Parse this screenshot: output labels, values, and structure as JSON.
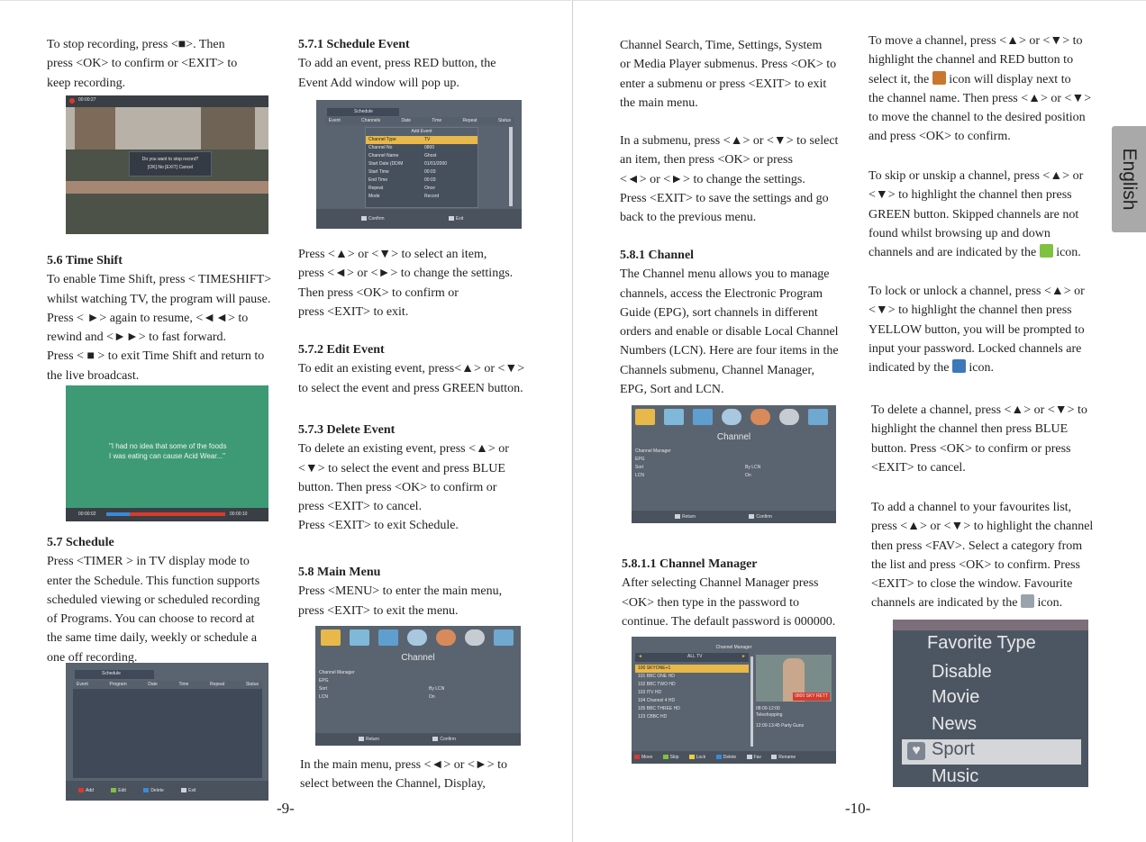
{
  "left_page": {
    "page_number": "-9-",
    "col1": {
      "recording_lines": [
        "To stop recording, press <■>. Then",
        "press <OK> to confirm or <EXIT> to",
        "keep recording."
      ],
      "recording_dialog_text": "Do you want to stop record?",
      "recording_dialog_sub": "[OK]  No [EXIT] Cancel",
      "recording_time": "00:00:27",
      "timeshift_heading": "5.6 Time Shift",
      "timeshift_lines": [
        "To enable Time Shift, press < TIMESHIFT>",
        "whilst watching TV, the program will pause.",
        "Press < ►> again to resume, <◄◄> to",
        "rewind and <►►> to fast forward.",
        "Press < ■ > to exit Time Shift and return to",
        "the live broadcast."
      ],
      "timeshift_caption": "\"I had no idea that some of the foods\nI was eating can cause Acid Wear...\"",
      "timeshift_time_left": "00:00:02",
      "timeshift_time_right": "00:00:10",
      "schedule_heading": "5.7 Schedule",
      "schedule_lines": [
        "Press <TIMER > in TV display mode to",
        "enter the Schedule. This function supports",
        "scheduled viewing or scheduled recording",
        "of Programs. You can choose to record at",
        "the same time daily, weekly or schedule a",
        "one off recording."
      ],
      "schedule_window_title": "Schedule",
      "schedule_columns": [
        "Event",
        "Program",
        "Date",
        "Time",
        "Repeat",
        "Status"
      ],
      "schedule_buttons": [
        "Add",
        "Edit",
        "Delete",
        "Exit"
      ]
    },
    "col2": {
      "event_heading": "5.7.1 Schedule Event",
      "event_lines": [
        "To add an event, press RED button, the",
        "Event Add window will pop up."
      ],
      "event_window_title": "Schedule",
      "event_columns": [
        "Event",
        "Channels",
        "Date",
        "Time",
        "Repeat",
        "Status"
      ],
      "event_add_title": "Add Event",
      "event_rows": [
        {
          "label": "Channel Type",
          "value": "TV"
        },
        {
          "label": "Channel No",
          "value": "0800"
        },
        {
          "label": "Channel Name",
          "value": "Ghost"
        },
        {
          "label": "Start Date (DD/M",
          "value": "01/01/2000"
        },
        {
          "label": "Start Time",
          "value": "00:03"
        },
        {
          "label": "End Time",
          "value": "00:03"
        },
        {
          "label": "Repeat",
          "value": "Once"
        },
        {
          "label": "Mode",
          "value": "Record"
        }
      ],
      "event_buttons": [
        "Confirm",
        "Exit"
      ],
      "nav_lines": [
        "Press <▲> or <▼> to select an item,",
        "press <◄> or <►> to change the settings.",
        "Then press <OK> to confirm or",
        "press <EXIT> to exit."
      ],
      "edit_heading": "5.7.2 Edit Event",
      "edit_lines": [
        "To edit an existing event, press<▲> or <▼>",
        " to select the event and press GREEN button."
      ],
      "delete_heading": "5.7.3 Delete Event",
      "delete_lines": [
        "To delete an existing event, press <▲> or",
        "<▼> to select the event and press BLUE",
        "button. Then press <OK> to confirm or",
        "press <EXIT> to cancel.",
        "Press <EXIT> to exit Schedule."
      ],
      "menu_heading": "5.8 Main Menu",
      "menu_lines": [
        "Press <MENU> to enter the main menu,",
        "press <EXIT> to exit the menu."
      ],
      "menu_title": "Channel",
      "menu_items": [
        {
          "label": "Channel Manager",
          "value": ""
        },
        {
          "label": "EPG",
          "value": ""
        },
        {
          "label": "Sort",
          "value": "By LCN"
        },
        {
          "label": "LCN",
          "value": "On"
        }
      ],
      "menu_buttons": [
        "Return",
        "Confirm"
      ],
      "main_lines": [
        "In the main menu, press <◄> or <►> to",
        "select between the Channel, Display,"
      ]
    }
  },
  "right_page": {
    "page_number": "-10-",
    "language_tab": "English",
    "col3": {
      "intro_lines": [
        "Channel Search, Time, Settings, System",
        "or Media Player submenus. Press <OK> to",
        "enter a submenu or press <EXIT> to exit",
        "the main menu."
      ],
      "submenu_lines": [
        "In a submenu, press <▲> or <▼> to select",
        "an item, then press <OK> or press",
        "<◄> or <►> to change the settings.",
        "Press <EXIT> to save the settings and go",
        "back to the previous menu."
      ],
      "channel_heading": "5.8.1 Channel",
      "channel_lines": [
        "The Channel menu allows you to manage",
        "channels, access the Electronic Program",
        "Guide (EPG), sort channels in different",
        "orders and enable or disable Local Channel",
        "Numbers (LCN). Here are four items in the",
        "Channels submenu, Channel Manager,",
        "EPG, Sort and LCN."
      ],
      "manager_heading": "5.8.1.1 Channel Manager",
      "manager_lines": [
        "After selecting Channel Manager press",
        "<OK> then type in the password to",
        "continue. The default password is 000000."
      ],
      "cm_title": "Channel Manager",
      "cm_filter": "ALL TV",
      "cm_channels": [
        "100 SKYONE+1",
        "101 BBC ONE HD",
        "102 BBC TWO HD",
        "103 ITV HD",
        "104 Channel 4 HD",
        "105 BBC THREE HD",
        "123 CBBC HD"
      ],
      "cm_info_1": "08:00-12:00",
      "cm_info_1b": "Teleshopping",
      "cm_info_2": "12:00-13:45  Party Guns",
      "cm_preview_badge": "0800 SKY  RETT",
      "cm_buttons": [
        "Move",
        "Skip",
        "Lock",
        "Delete",
        "Fav",
        "Rename"
      ]
    },
    "col4": {
      "move_lines": [
        "To move a channel, press <▲> or <▼> to",
        "highlight the channel and RED button to",
        "select it, the",
        "icon will display next to",
        "the channel name. Then press <▲> or <▼>",
        "to move the channel to the desired position",
        "and press <OK> to confirm."
      ],
      "skip_lines": [
        "To skip or unskip a channel, press <▲> or",
        "<▼> to highlight the channel then press",
        "GREEN button. Skipped channels are not",
        "found whilst browsing up and down",
        "channels and are indicated by the",
        "icon."
      ],
      "lock_lines": [
        "To lock or unlock a channel, press <▲> or",
        "<▼> to highlight the channel then press",
        "YELLOW button, you will be prompted to",
        "input your password. Locked channels are",
        "indicated by the",
        "icon."
      ],
      "delete_lines": [
        "To delete a channel, press <▲> or <▼> to",
        "highlight the channel then press BLUE",
        "button. Press <OK> to confirm or press",
        "<EXIT> to cancel."
      ],
      "fav_lines": [
        "To add a channel to your favourites list,",
        "press <▲> or <▼> to highlight the channel",
        "then press <FAV>. Select a category from",
        "the list and press <OK> to confirm. Press",
        "<EXIT> to close the window. Favourite",
        "channels are indicated by the",
        "icon."
      ],
      "fav_title": "Favorite Type",
      "fav_options": [
        "Disable",
        "Movie",
        "News",
        "Sport",
        "Music"
      ]
    }
  },
  "colors": {
    "red": "#d83a2e",
    "green": "#7fc240",
    "yellow": "#e8d23a",
    "blue": "#3a8ad8",
    "highlight": "#e8b84a"
  },
  "icons": {
    "move": "move-icon",
    "skip": "skip-icon",
    "lock": "lock-icon",
    "favourite": "heart-icon"
  }
}
